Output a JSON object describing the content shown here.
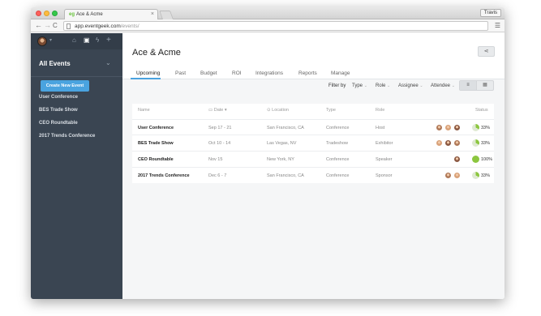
{
  "browser": {
    "tab_title": "Ace & Acme",
    "tab_favicon": "eg",
    "tab_close": "×",
    "user_name": "Travis",
    "url_host": "app.eventgeek.com",
    "url_path": "/events/"
  },
  "sidebar": {
    "title": "All Events",
    "items": [
      {
        "label": "User Conference"
      },
      {
        "label": "BES Trade Show"
      },
      {
        "label": "CEO Roundtable"
      },
      {
        "label": "2017 Trends Conference"
      }
    ],
    "icons": [
      "home-icon",
      "suitcase-icon",
      "bolt-icon",
      "plus-icon"
    ]
  },
  "header": {
    "title": "Ace & Acme",
    "tabs": [
      {
        "label": "Upcoming"
      },
      {
        "label": "Past"
      },
      {
        "label": "Budget"
      },
      {
        "label": "ROI"
      },
      {
        "label": "Integrations"
      },
      {
        "label": "Reports"
      },
      {
        "label": "Manage"
      }
    ],
    "active_tab": "Upcoming"
  },
  "toolbar": {
    "create_label": "Create New Event",
    "filter_label": "Filter by",
    "filters": [
      {
        "label": "Type"
      },
      {
        "label": "Role"
      },
      {
        "label": "Assignee"
      },
      {
        "label": "Attendee"
      }
    ]
  },
  "table": {
    "headers": {
      "name": "Name",
      "date": "Date",
      "location": "Location",
      "type": "Type",
      "role": "Role",
      "status": "Status"
    },
    "rows": [
      {
        "name": "User Conference",
        "date": "Sep 17 - 21",
        "location": "San Francisco, CA",
        "type": "Conference",
        "role": "Host",
        "attendees": 3,
        "status": "33%",
        "progress": 0.33
      },
      {
        "name": "BES Trade Show",
        "date": "Oct 10 - 14",
        "location": "Las Vegas, NV",
        "type": "Tradeshow",
        "role": "Exhibitor",
        "attendees": 3,
        "status": "33%",
        "progress": 0.33
      },
      {
        "name": "CEO Roundtable",
        "date": "Nov 15",
        "location": "New York, NY",
        "type": "Conference",
        "role": "Speaker",
        "attendees": 1,
        "status": "100%",
        "progress": 1.0
      },
      {
        "name": "2017 Trends Conference",
        "date": "Dec 6 - 7",
        "location": "San Francisco, CA",
        "type": "Conference",
        "role": "Sponsor",
        "attendees": 2,
        "status": "33%",
        "progress": 0.33
      }
    ]
  },
  "colors": {
    "accent": "#4aa3df",
    "sidebar_bg": "#3a4552",
    "progress_green": "#8cc63f"
  }
}
